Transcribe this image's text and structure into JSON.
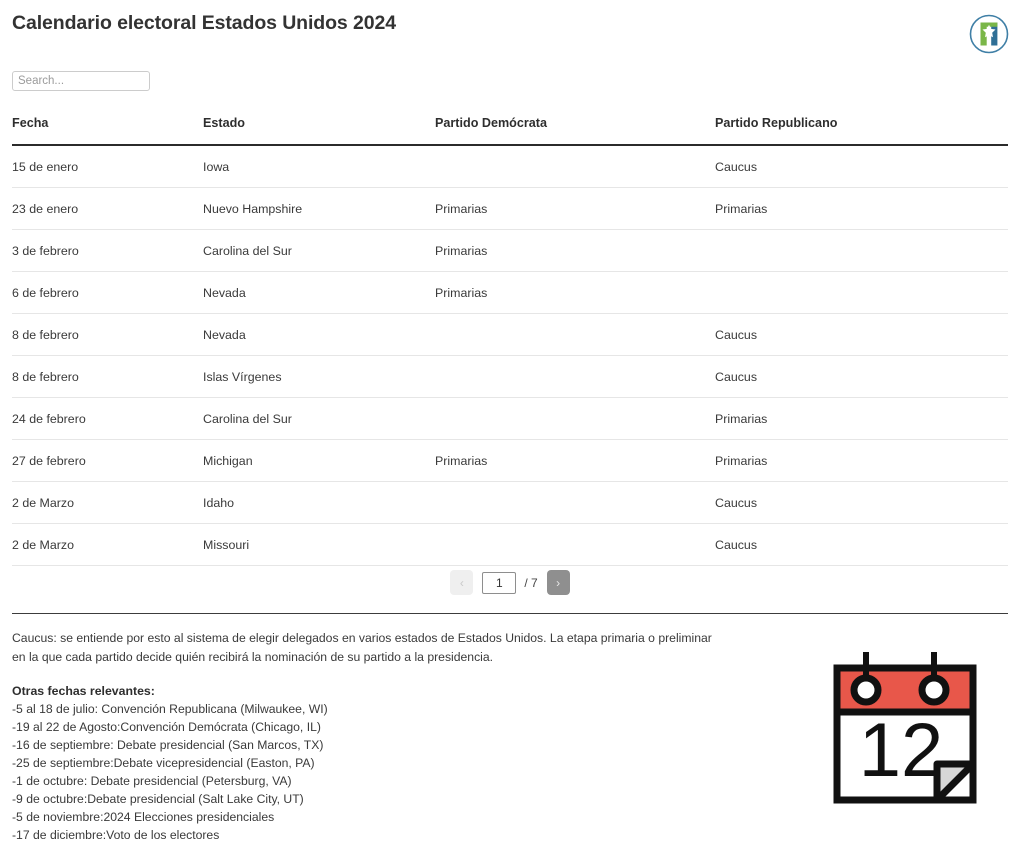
{
  "header": {
    "title": "Calendario electoral Estados Unidos 2024",
    "logo_name": "site-logo"
  },
  "search": {
    "placeholder": "Search...",
    "value": ""
  },
  "table": {
    "columns": [
      "Fecha",
      "Estado",
      "Partido Demócrata",
      "Partido Republicano"
    ],
    "rows": [
      {
        "fecha": "15 de enero",
        "estado": "Iowa",
        "democrata": "",
        "republicano": "Caucus"
      },
      {
        "fecha": "23 de enero",
        "estado": "Nuevo Hampshire",
        "democrata": "Primarias",
        "republicano": "Primarias"
      },
      {
        "fecha": "3 de febrero",
        "estado": "Carolina del Sur",
        "democrata": "Primarias",
        "republicano": ""
      },
      {
        "fecha": "6 de febrero",
        "estado": "Nevada",
        "democrata": "Primarias",
        "republicano": ""
      },
      {
        "fecha": "8 de febrero",
        "estado": "Nevada",
        "democrata": "",
        "republicano": "Caucus"
      },
      {
        "fecha": "8 de febrero",
        "estado": "Islas Vírgenes",
        "democrata": "",
        "republicano": "Caucus"
      },
      {
        "fecha": "24 de febrero",
        "estado": "Carolina del Sur",
        "democrata": "",
        "republicano": "Primarias"
      },
      {
        "fecha": "27 de febrero",
        "estado": "Michigan",
        "democrata": "Primarias",
        "republicano": "Primarias"
      },
      {
        "fecha": "2 de Marzo",
        "estado": "Idaho",
        "democrata": "",
        "republicano": "Caucus"
      },
      {
        "fecha": "2 de Marzo",
        "estado": "Missouri",
        "democrata": "",
        "republicano": "Caucus"
      }
    ]
  },
  "pagination": {
    "prev_label": "‹",
    "next_label": "›",
    "current_page": "1",
    "total_label": "/ 7",
    "total_pages": 7
  },
  "footer": {
    "note": "Caucus: se entiende por esto al sistema de elegir delegados en varios estados de Estados Unidos. La etapa primaria o preliminar en la que cada partido decide quién recibirá la nominación de su partido a la presidencia.",
    "dates_title": "Otras fechas relevantes:",
    "dates": [
      "-5 al 18 de julio: Convención Republicana (Milwaukee, WI)",
      "-19 al 22 de Agosto:Convención Demócrata (Chicago, IL)",
      "-16 de septiembre: Debate presidencial (San Marcos, TX)",
      "-25 de septiembre:Debate vicepresidencial (Easton, PA)",
      "-1 de octubre: Debate presidencial (Petersburg, VA)",
      "-9 de octubre:Debate presidencial (Salt Lake City, UT)",
      "-5 de noviembre:2024 Elecciones presidenciales",
      "-17 de diciembre:Voto de los electores"
    ]
  },
  "calendar_icon": {
    "day_number": "12",
    "band_color": "#e8574a",
    "outline_color": "#111111",
    "fold_color": "#d7d7d7"
  },
  "colors": {
    "text": "#3a3a3a",
    "heading": "#2e2e2e",
    "rule": "#2b2b2b",
    "row_divider": "#e6e6e6",
    "logo_green": "#7ab648",
    "logo_blue": "#2f6f96",
    "logo_ring": "#3f7fa6"
  }
}
